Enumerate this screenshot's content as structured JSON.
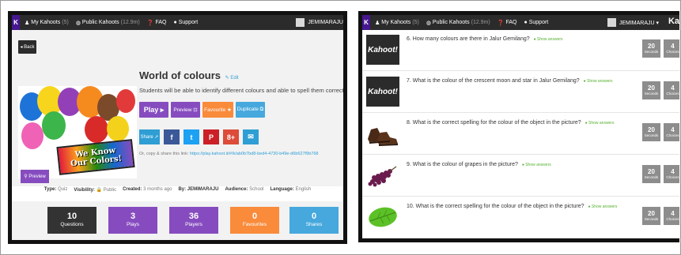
{
  "left_panel": {
    "topbar": {
      "nav": [
        {
          "icon": "person-icon",
          "label": "My Kahoots",
          "count": "(5)"
        },
        {
          "icon": "globe-icon",
          "label": "Public Kahoots",
          "count": "(12.9m)"
        },
        {
          "icon": "question-icon",
          "label": "FAQ",
          "count": ""
        },
        {
          "icon": "chat-icon",
          "label": "Support",
          "count": ""
        }
      ],
      "username": "JEMIMARAJU"
    },
    "back_label": "◂ Back",
    "preview_chip": "⚲ Preview",
    "cover_banner": [
      "We Know",
      "Our Colors!"
    ],
    "kahoot": {
      "title": "World of colours",
      "edit_label": "✎ Edit",
      "description": "Students will be able to identify different colours and able to spell them correctly."
    },
    "actions": {
      "play": "Play ▸",
      "preview": "Preview ⊡",
      "favourite": "Favourite ★",
      "duplicate": "Duplicate ⧉"
    },
    "share": {
      "share_label": "Share ➚",
      "facebook": "f",
      "twitter": "t",
      "pinterest": "P",
      "googleplus": "8+",
      "email": "✉",
      "link_prefix": "Or, copy & share this link: ",
      "link_url": "https://play.kahoot.it/#/k/ab0b7bd8-bed4-4730-b49e-d6b627f9b768"
    },
    "meta": {
      "type_label": "Type:",
      "type_value": "Quiz",
      "visibility_label": "Visibility:",
      "visibility_value": "🔒 Public",
      "created_label": "Created:",
      "created_value": "3 months ago",
      "by_label": "By:",
      "by_value": "JEMIMARAJU",
      "audience_label": "Audience:",
      "audience_value": "School",
      "language_label": "Language:",
      "language_value": "English"
    },
    "stats": [
      {
        "value": "10",
        "label": "Questions",
        "color": "#333333"
      },
      {
        "value": "3",
        "label": "Plays",
        "color": "#864cbf"
      },
      {
        "value": "36",
        "label": "Players",
        "color": "#864cbf"
      },
      {
        "value": "0",
        "label": "Favourites",
        "color": "#f98b3b"
      },
      {
        "value": "0",
        "label": "Shares",
        "color": "#46a8dd"
      }
    ]
  },
  "right_panel": {
    "topbar": {
      "nav": [
        {
          "icon": "person-icon",
          "label": "My Kahoots",
          "count": "(5)"
        },
        {
          "icon": "globe-icon",
          "label": "Public Kahoots",
          "count": "(12.9m)"
        },
        {
          "icon": "question-icon",
          "label": "FAQ",
          "count": ""
        },
        {
          "icon": "chat-icon",
          "label": "Support",
          "count": ""
        }
      ],
      "username": "JEMIMARAJU ▾",
      "logo": "Ka"
    },
    "show_answers_label": "● Show answers",
    "seconds_label": "Seconds",
    "choices_label": "Choices",
    "questions": [
      {
        "text": "6. How many colours are there in Jalur Gemilang?",
        "seconds": "20",
        "choices": "4",
        "thumb": "kahoot-logo",
        "thumb_text": "Kahoot!"
      },
      {
        "text": "7. What is the colour of the crescent moon and star in Jalur Gemilang?",
        "seconds": "20",
        "choices": "4",
        "thumb": "kahoot-logo",
        "thumb_text": "Kahoot!"
      },
      {
        "text": "8. What is the correct spelling for the colour of the object in the picture?",
        "seconds": "20",
        "choices": "4",
        "thumb": "brown-shoes"
      },
      {
        "text": "9. What is the colour of grapes in the picture?",
        "seconds": "20",
        "choices": "4",
        "thumb": "grapes"
      },
      {
        "text": "10. What is the correct spelling for the colour of the object in the picture?",
        "seconds": "20",
        "choices": "4",
        "thumb": "green-leaf"
      }
    ]
  },
  "colors": {
    "topbar": "#2b2b2b",
    "purple": "#864cbf",
    "orange": "#f98b3b",
    "blue": "#46a8dd",
    "duration_box": "#8d8d8d",
    "show_answers": "#57b030"
  }
}
